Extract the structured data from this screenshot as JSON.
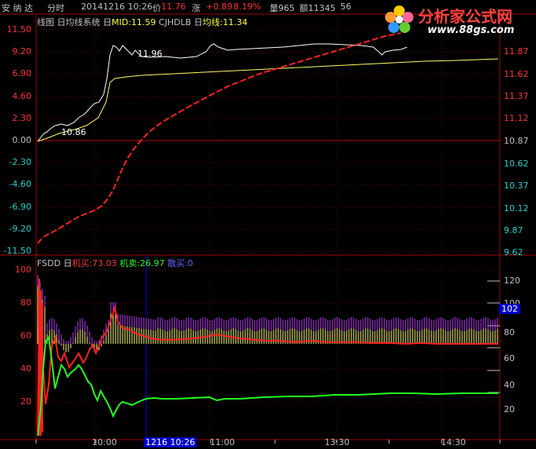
{
  "header": {
    "stock_name": "安 纳 达",
    "mode": "分时",
    "datetime": "20141216 10:26",
    "price_label": "价",
    "price": "11.76",
    "change_label": "涨",
    "change": "+0.89",
    "pct": "8.19%",
    "volume_label": "量965",
    "amount_label": "额11345",
    "extra": "56"
  },
  "upper_legend": {
    "item1": "线图",
    "item2": "日均线系统",
    "item3_prefix": "日",
    "mid_label": "MID:11.59",
    "item4": "CJHDLB",
    "item5_prefix": "日",
    "avg_label": "均线:11.34"
  },
  "lower_legend": {
    "name": "FSDD",
    "prefix": "日",
    "buy": "机买:73.03",
    "sell": "机卖:26.97",
    "retail": "散买:0"
  },
  "left_axis_upper": [
    {
      "v": "11.50",
      "c": "#ff3030"
    },
    {
      "v": "9.20",
      "c": "#ff3030"
    },
    {
      "v": "6.90",
      "c": "#ff3030"
    },
    {
      "v": "4.60",
      "c": "#ff3030"
    },
    {
      "v": "2.30",
      "c": "#ff3030"
    },
    {
      "v": "0.00",
      "c": "#c0c0c0"
    },
    {
      "v": "-2.30",
      "c": "#20d0d0"
    },
    {
      "v": "-4.60",
      "c": "#20d0d0"
    },
    {
      "v": "-6.90",
      "c": "#20d0d0"
    },
    {
      "v": "-9.20",
      "c": "#20d0d0"
    },
    {
      "v": "-11.50",
      "c": "#20d0d0"
    }
  ],
  "right_axis_upper": [
    {
      "v": "11.87",
      "c": "#ff3030"
    },
    {
      "v": "11.62",
      "c": "#ff3030"
    },
    {
      "v": "11.37",
      "c": "#ff3030"
    },
    {
      "v": "11.12",
      "c": "#ff3030"
    },
    {
      "v": "10.87",
      "c": "#c0c0c0"
    },
    {
      "v": "10.62",
      "c": "#20d0d0"
    },
    {
      "v": "10.37",
      "c": "#20d0d0"
    },
    {
      "v": "10.12",
      "c": "#20d0d0"
    },
    {
      "v": "9.87",
      "c": "#20d0d0"
    },
    {
      "v": "9.62",
      "c": "#20d0d0"
    }
  ],
  "left_axis_lower": [
    "100",
    "80",
    "60",
    "40",
    "20"
  ],
  "right_axis_lower": [
    "120",
    "100",
    "80",
    "60",
    "40",
    "20"
  ],
  "current_volume_marker": "102",
  "price_annotations": {
    "high": "11.96",
    "low": "10.86"
  },
  "time_axis": [
    "10:00",
    "11:00",
    "13:30",
    "14:30"
  ],
  "cursor_time": "1216 10:26",
  "logo": {
    "title": "分析家公式网",
    "url": "www.88gs.com"
  },
  "colors": {
    "price_line": "#ffffff",
    "avg_line": "#ffff66",
    "mid_line": "#ff2020",
    "buy_line": "#ff2020",
    "sell_line": "#20ff20",
    "bars_purple": "#c040ff",
    "bars_yellow": "#ffff80",
    "grid": "#800000",
    "up": "#ff3030",
    "down": "#20d0d0"
  }
}
